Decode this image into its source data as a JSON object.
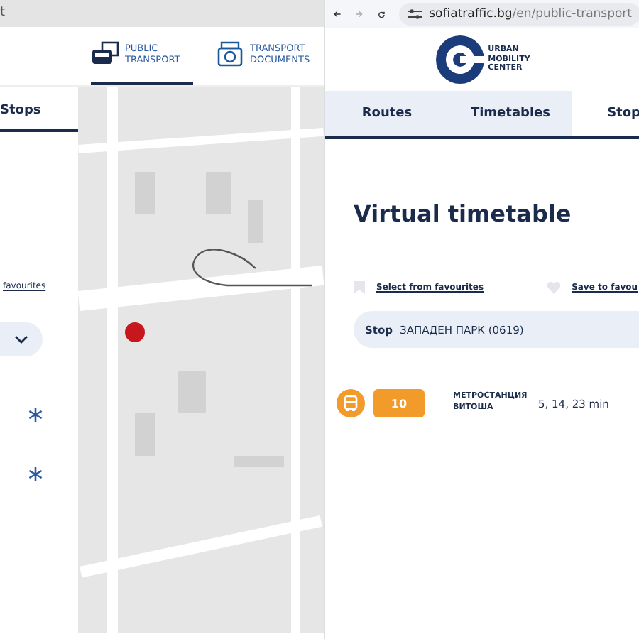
{
  "left_page": {
    "address_fragment": "t",
    "nav": [
      {
        "label": "PUBLIC TRANSPORT",
        "selected": true
      },
      {
        "label": "TRANSPORT DOCUMENTS",
        "selected": false
      }
    ],
    "tab": {
      "label": "Stops",
      "selected": true
    },
    "favourites_link": "favourites"
  },
  "browser": {
    "url_domain": "sofiatraffic.bg",
    "url_path": "/en/public-transport"
  },
  "right_page": {
    "logo_text": [
      "URBAN",
      "MOBILITY",
      "CENTER"
    ],
    "tabs": [
      {
        "label": "Routes",
        "selected": false
      },
      {
        "label": "Timetables",
        "selected": false
      },
      {
        "label": "Stop",
        "selected": true
      }
    ],
    "title": "Virtual timetable",
    "select_favourites": "Select from favourites",
    "save_favourites": "Save to favou",
    "stop_label": "Stop",
    "stop_value": "ЗАПАДЕН ПАРК (0619)",
    "departures": [
      {
        "line": "10",
        "destination": "МЕТРОСТАНЦИЯ ВИТОША",
        "times": "5, 14, 23 min"
      }
    ]
  }
}
